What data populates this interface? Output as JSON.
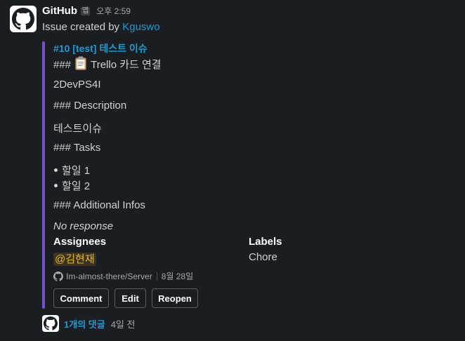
{
  "message": {
    "sender": "GitHub",
    "app_badge": "앱",
    "time": "오후 2:59",
    "subline_prefix": "Issue created by",
    "author": "Kguswo"
  },
  "issue": {
    "title": "#10 [test] 테스트 이슈",
    "heading_prefix": "###",
    "heading_text": "Trello 카드 연결",
    "trello_id": "2DevPS4I",
    "description_heading": "### Description",
    "description_body": "테스트이슈",
    "tasks_heading": "### Tasks",
    "tasks": [
      "할일 1",
      "할일 2"
    ],
    "additional_heading": "### Additional Infos",
    "no_response": "No response"
  },
  "fields": {
    "assignees_label": "Assignees",
    "assignee": "@김현재",
    "labels_label": "Labels",
    "label_value": "Chore"
  },
  "footer": {
    "repo": "Im-almost-there/Server",
    "date": "8월 28일"
  },
  "buttons": {
    "comment": "Comment",
    "edit": "Edit",
    "reopen": "Reopen"
  },
  "replies": {
    "count_text": "1개의 댓글",
    "time": "4일 전"
  },
  "colors": {
    "background": "#1a1d21",
    "link": "#1d9bd1",
    "attachment_bar": "#7b4ae0",
    "mention_text": "#e8b42c"
  }
}
